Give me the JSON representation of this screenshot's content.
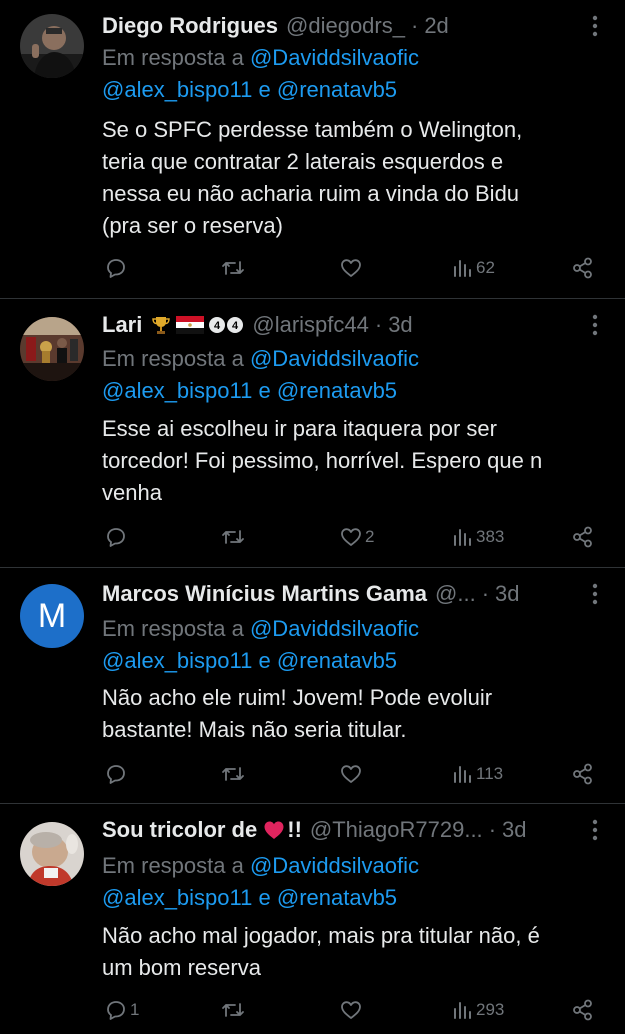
{
  "colors": {
    "background": "#000000",
    "text": "#e7e9ea",
    "muted": "#71767b",
    "link": "#1d9bf0",
    "divider": "#2f3336",
    "avatar_m": "#1d6fc9"
  },
  "tweets": [
    {
      "name": "Diego Rodrigues",
      "handle": "@diegodrs_",
      "dot": "·",
      "time": "2d",
      "reply_prefix": "Em resposta a",
      "mention1": "@Daviddsilvaofic",
      "mention2": "@alex_bispo11",
      "conj": "e",
      "mention3": "@renatavb5",
      "text_lines": [
        "Se o SPFC perdesse também o Welington,",
        "teria que contratar 2 laterais esquerdos e",
        "nessa eu não acharia ruim a vinda do Bidu",
        "(pra ser o reserva)"
      ],
      "reply_count": "",
      "retweet_count": "",
      "like_count": "",
      "views": "62",
      "avatar": "photo-man"
    },
    {
      "name": "Lari",
      "badges": [
        "trophy-icon",
        "flag-icon",
        "number-44-icon"
      ],
      "badge_text": "44",
      "handle": "@larispfc44",
      "dot": "·",
      "time": "3d",
      "reply_prefix": "Em resposta a",
      "mention1": "@Daviddsilvaofic",
      "mention2": "@alex_bispo11",
      "conj": "e",
      "mention3": "@renatavb5",
      "text_lines": [
        "Esse ai escolheu ir para itaquera por ser",
        "torcedor! Foi pessimo, horrível. Espero que n",
        "venha"
      ],
      "reply_count": "",
      "retweet_count": "",
      "like_count": "2",
      "views": "383",
      "avatar": "photo-trophy-room"
    },
    {
      "name": "Marcos Winícius Martins Gama",
      "handle": "@...",
      "dot": "·",
      "time": "3d",
      "reply_prefix": "Em resposta a",
      "mention1": "@Daviddsilvaofic",
      "mention2": "@alex_bispo11",
      "conj": "e",
      "mention3": "@renatavb5",
      "text_lines": [
        "Não acho ele ruim! Jovem! Pode evoluir",
        "bastante! Mais não seria titular."
      ],
      "reply_count": "",
      "retweet_count": "",
      "like_count": "",
      "views": "113",
      "avatar_letter": "M"
    },
    {
      "name": "Sou tricolor de",
      "name_suffix": "!!",
      "handle": "@ThiagoR7729...",
      "dot": "·",
      "time": "3d",
      "reply_prefix": "Em resposta a",
      "mention1": "@Daviddsilvaofic",
      "mention2": "@alex_bispo11",
      "conj": "e",
      "mention3": "@renatavb5",
      "text_lines": [
        "Não acho mal jogador, mais pra titular não, é",
        "um bom reserva"
      ],
      "reply_count": "1",
      "retweet_count": "",
      "like_count": "",
      "views": "293",
      "avatar": "photo-blurred"
    }
  ]
}
